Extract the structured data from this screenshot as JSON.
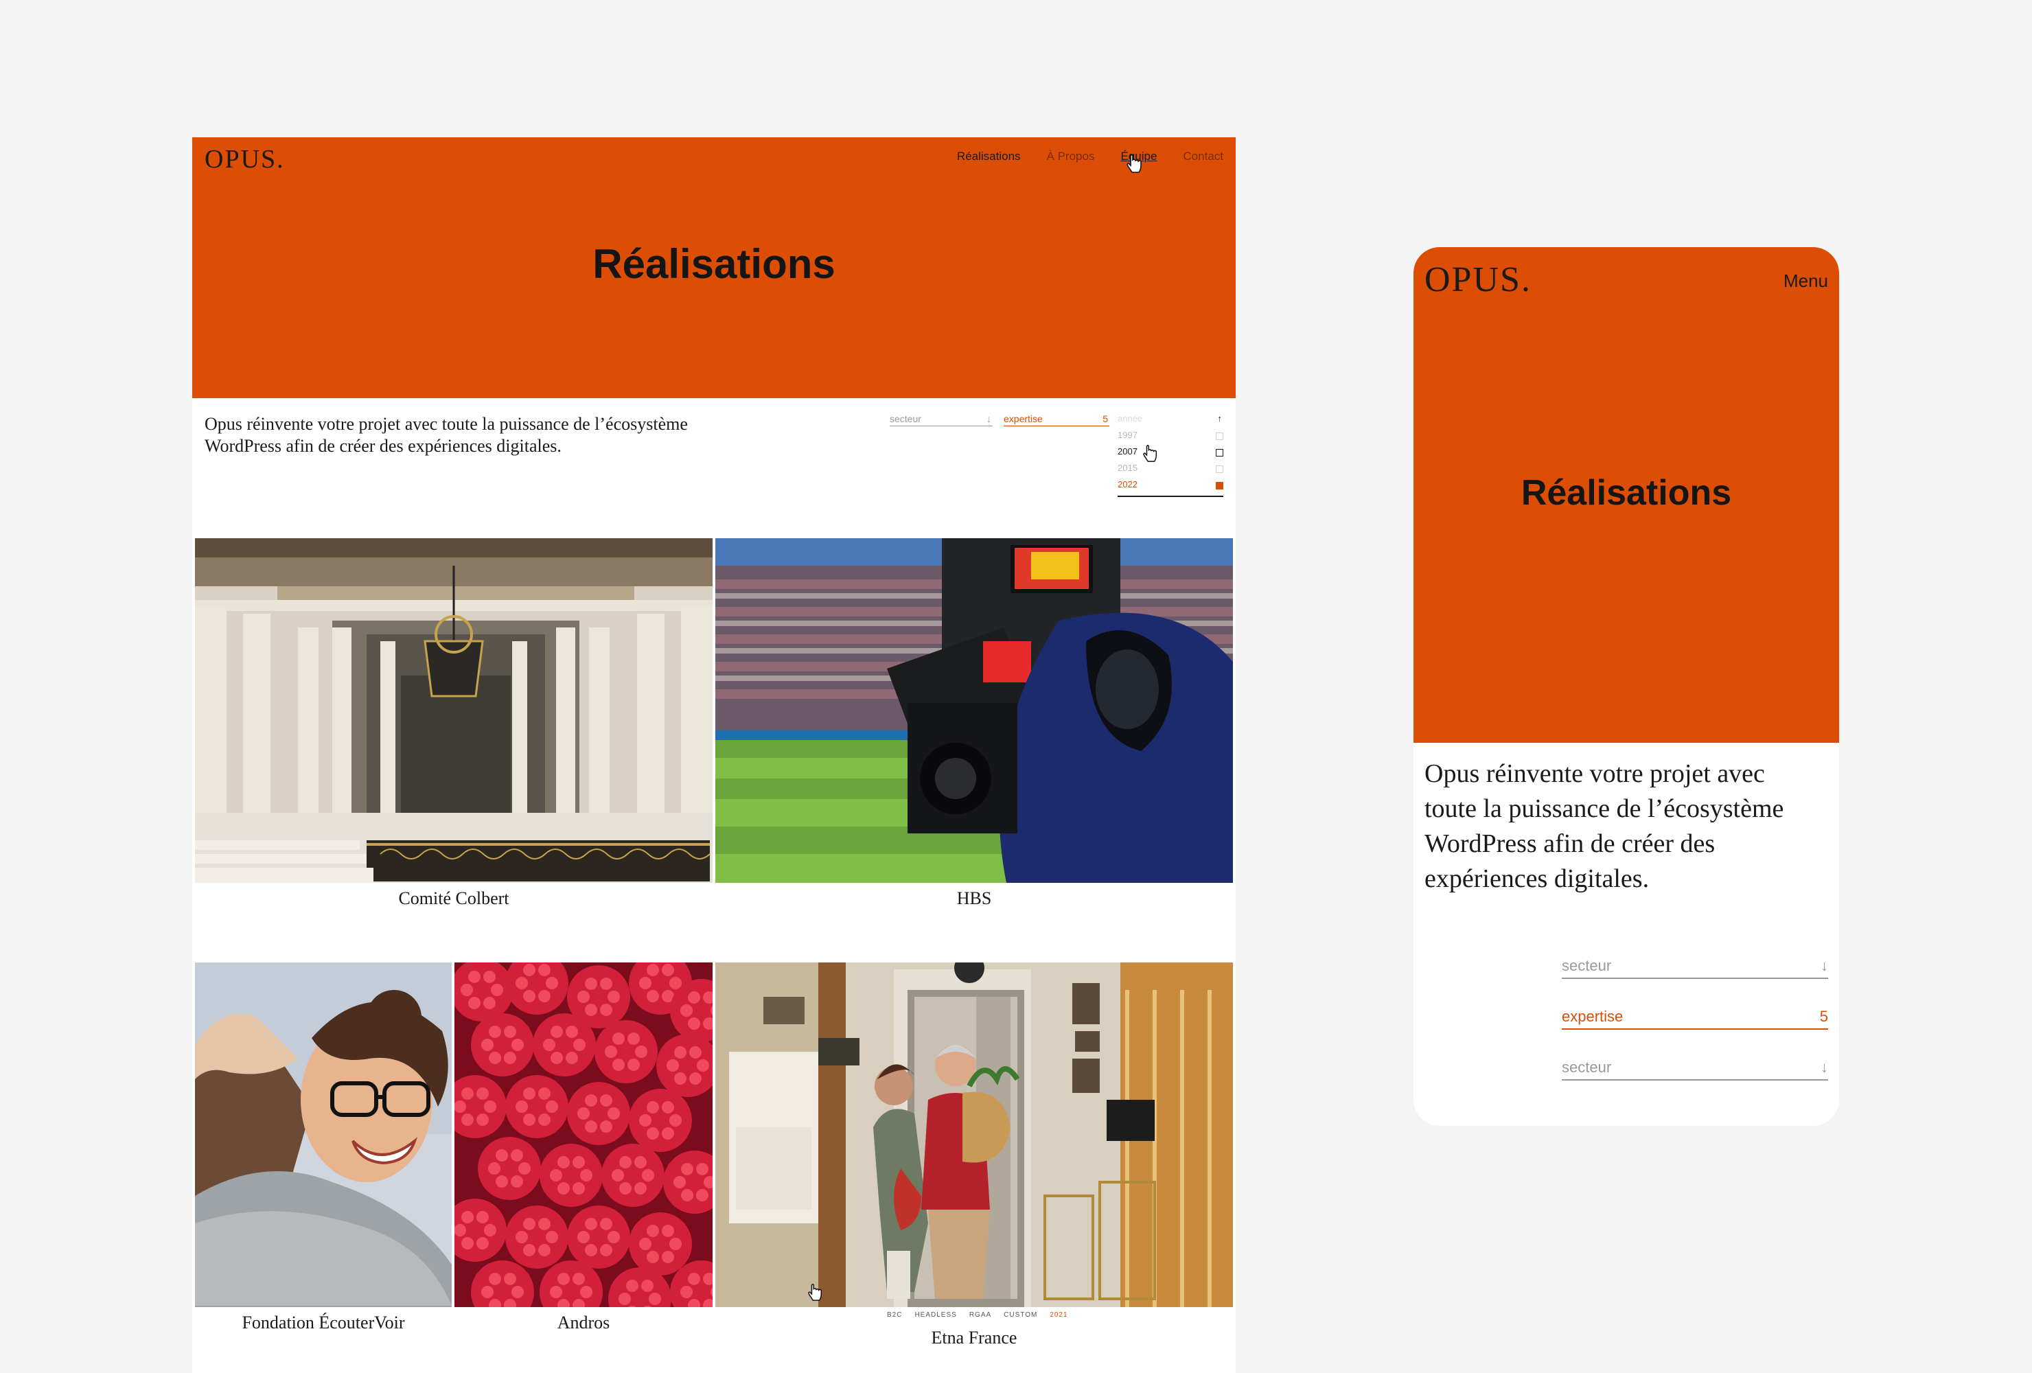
{
  "brand": {
    "logo": "OPUS.",
    "accent": "#dc4e05"
  },
  "desktop": {
    "nav": [
      "Réalisations",
      "À Propos",
      "Équipe",
      "Contact"
    ],
    "title": "Réalisations",
    "intro": "Opus réinvente votre projet avec toute la puissance de l’écosystème WordPress afin de créer des expériences digitales.",
    "filters": {
      "secteur": {
        "label": "secteur",
        "arrow": "↓"
      },
      "expertise": {
        "label": "expertise",
        "count": "5"
      },
      "annee": {
        "label": "année",
        "arrow": "↑",
        "options": [
          {
            "label": "1997",
            "state": "unchecked"
          },
          {
            "label": "2007",
            "state": "hover"
          },
          {
            "label": "2015",
            "state": "unchecked"
          },
          {
            "label": "2022",
            "state": "checked"
          }
        ]
      }
    },
    "projects": [
      {
        "name": "Comité Colbert",
        "image": "palace-hall-image"
      },
      {
        "name": "HBS",
        "image": "stadium-camera-image"
      },
      {
        "name": "Fondation ÉcouterVoir",
        "image": "hugging-women-image"
      },
      {
        "name": "Andros",
        "image": "raspberries-image"
      },
      {
        "name": "Etna France",
        "image": "home-lift-image"
      }
    ],
    "hover_tags": [
      "B2C",
      "HEADLESS",
      "RGAA",
      "CUSTOM"
    ],
    "hover_year": "2021"
  },
  "mobile": {
    "menu": "Menu",
    "title": "Réalisations",
    "intro_lines": [
      "Opus réinvente votre projet avec",
      "toute la puissance de l’écosystème",
      "WordPress afin de créer des",
      "expériences digitales."
    ],
    "filters": [
      {
        "label": "secteur",
        "right": "↓",
        "state": "default"
      },
      {
        "label": "expertise",
        "right": "5",
        "state": "active"
      },
      {
        "label": "secteur",
        "right": "↓",
        "state": "default"
      }
    ]
  }
}
